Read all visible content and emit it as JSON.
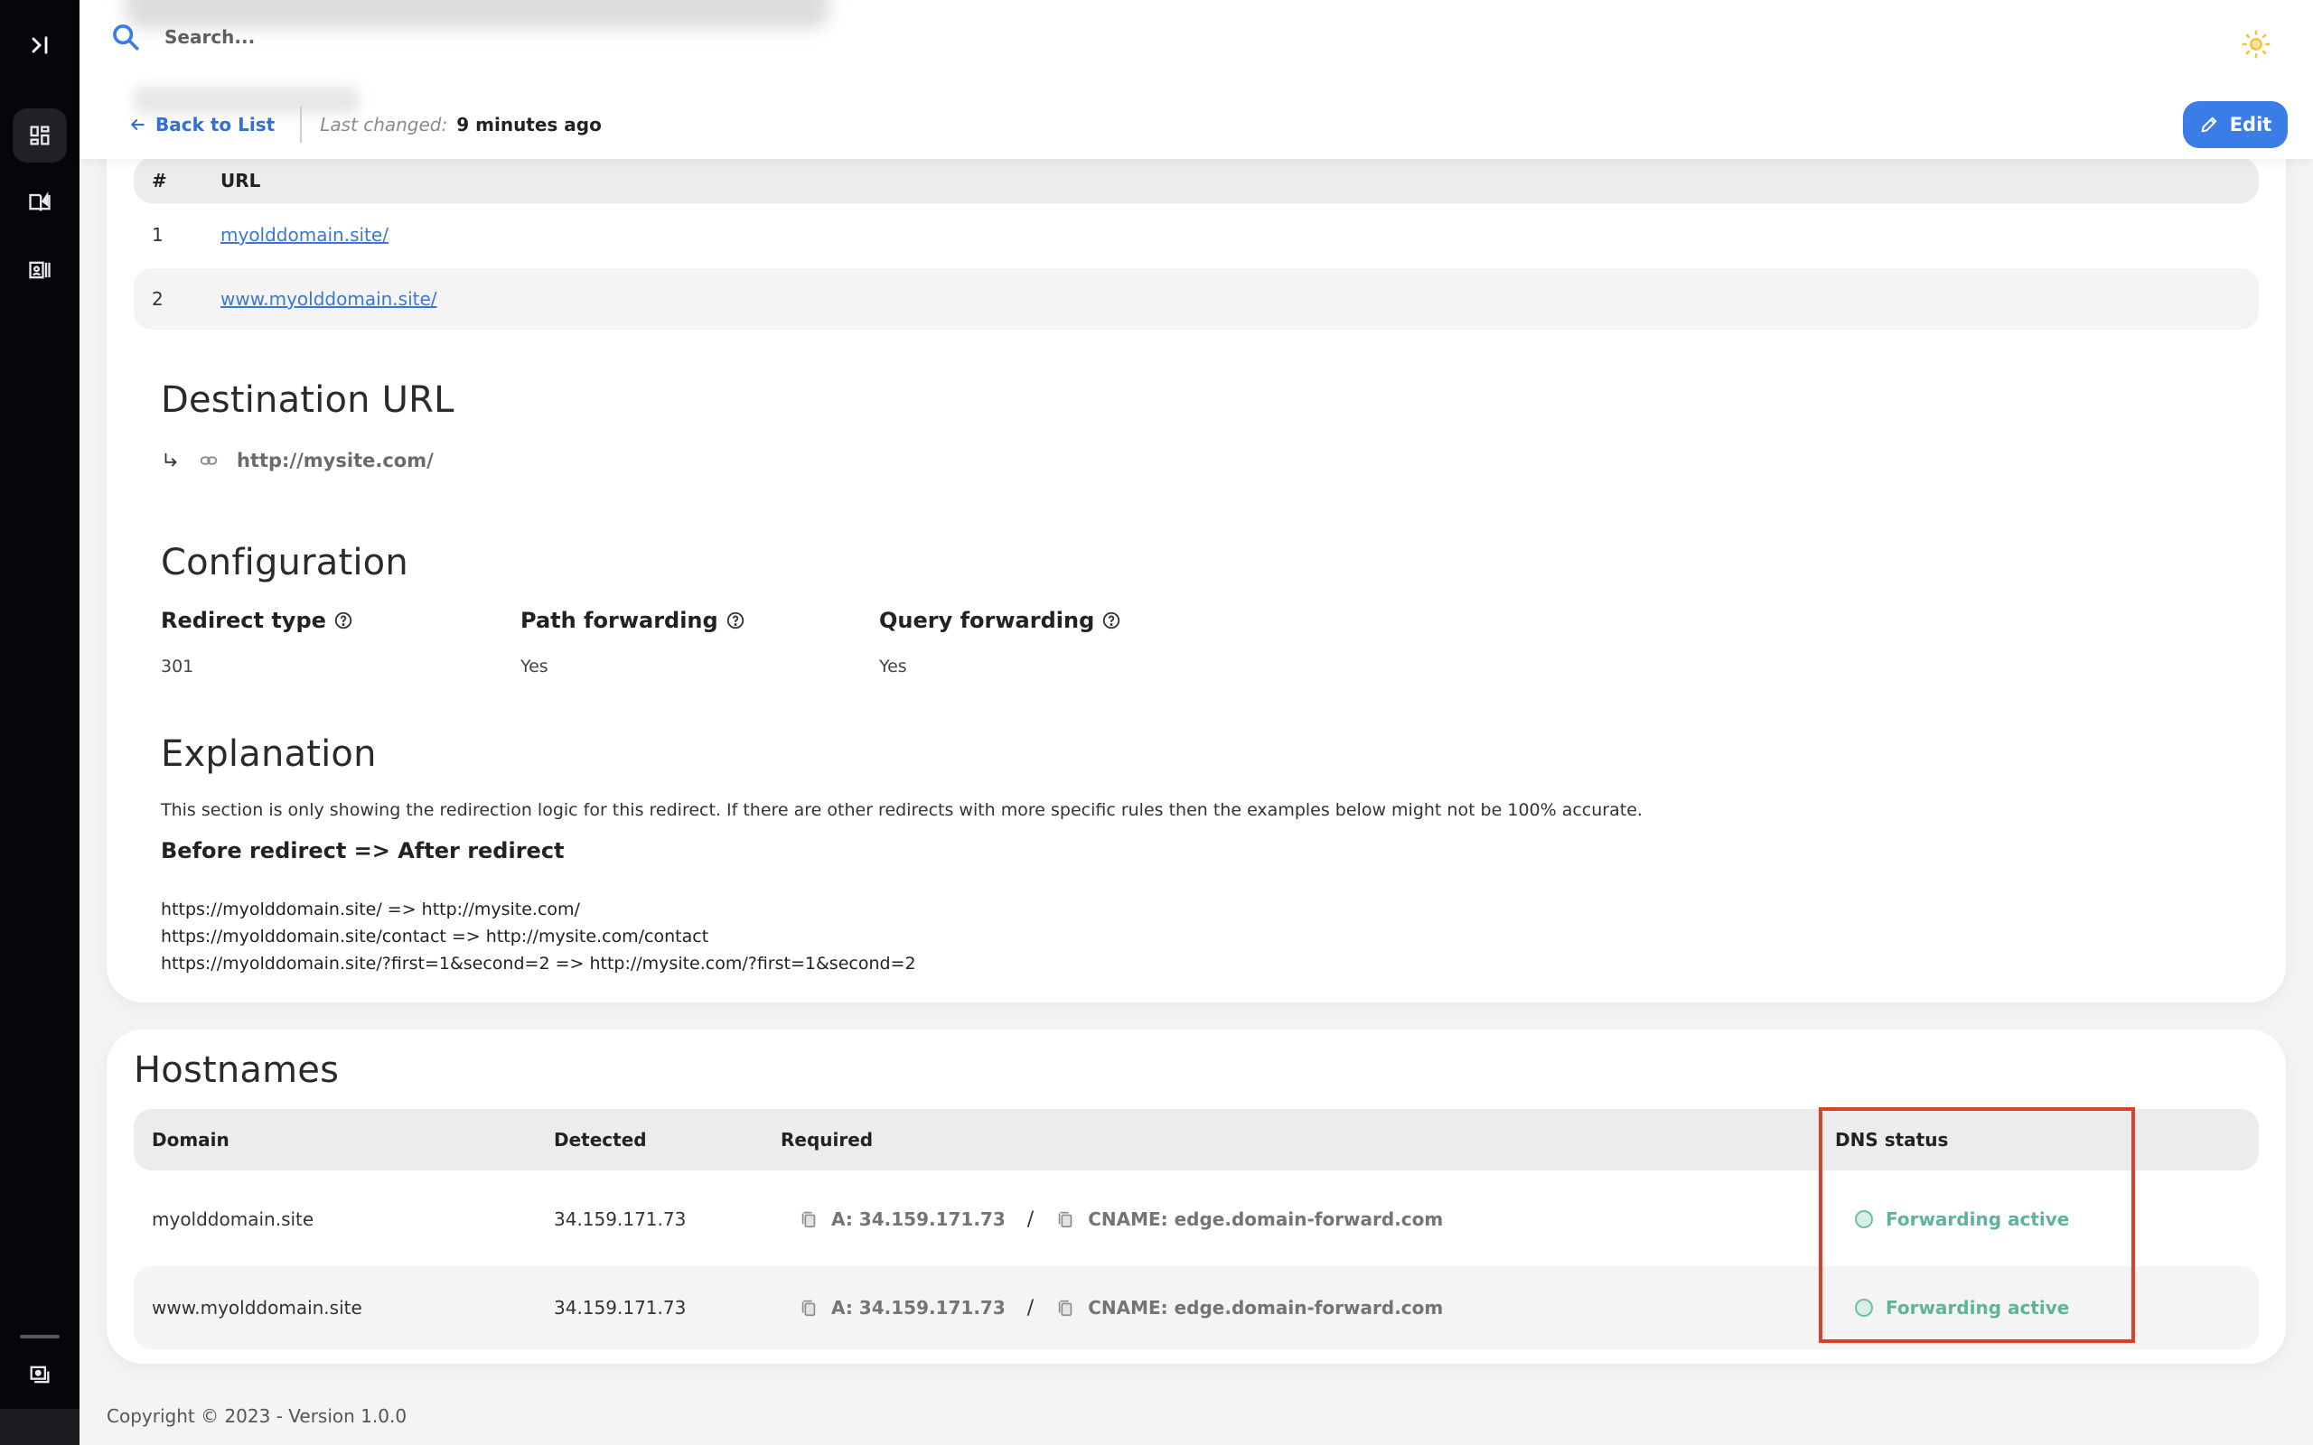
{
  "header": {
    "search_placeholder": "Search...",
    "back_label": "Back to List",
    "last_changed_label": "Last changed:",
    "last_changed_value": "9 minutes ago",
    "edit_label": "Edit"
  },
  "sidebar": {
    "items": [
      {
        "name": "expand-sidebar",
        "icon": "expand-icon"
      },
      {
        "name": "dashboard",
        "icon": "dashboard-icon",
        "active": true
      },
      {
        "name": "docs",
        "icon": "book-icon"
      },
      {
        "name": "contacts",
        "icon": "contact-card-icon"
      },
      {
        "name": "media",
        "icon": "media-icon"
      }
    ]
  },
  "source_urls": {
    "columns": [
      "#",
      "URL"
    ],
    "rows": [
      {
        "index": "1",
        "url": "myolddomain.site/"
      },
      {
        "index": "2",
        "url": "www.myolddomain.site/"
      }
    ]
  },
  "destination": {
    "title": "Destination URL",
    "url": "http://mysite.com/"
  },
  "configuration": {
    "title": "Configuration",
    "items": [
      {
        "label": "Redirect type",
        "value": "301"
      },
      {
        "label": "Path forwarding",
        "value": "Yes"
      },
      {
        "label": "Query forwarding",
        "value": "Yes"
      }
    ]
  },
  "explanation": {
    "title": "Explanation",
    "text": "This section is only showing the redirection logic for this redirect. If there are other redirects with more specific rules then the examples below might not be 100% accurate.",
    "subheading": "Before redirect => After redirect",
    "examples": [
      "https://myolddomain.site/ => http://mysite.com/",
      "https://myolddomain.site/contact => http://mysite.com/contact",
      "https://myolddomain.site/?first=1&second=2 => http://mysite.com/?first=1&second=2"
    ]
  },
  "hostnames": {
    "title": "Hostnames",
    "columns": [
      "Domain",
      "Detected",
      "Required",
      "DNS status"
    ],
    "rows": [
      {
        "domain": "myolddomain.site",
        "detected": "34.159.171.73",
        "required_a": "A: 34.159.171.73",
        "separator": "/",
        "required_cname": "CNAME: edge.domain-forward.com",
        "status": "Forwarding active"
      },
      {
        "domain": "www.myolddomain.site",
        "detected": "34.159.171.73",
        "required_a": "A: 34.159.171.73",
        "separator": "/",
        "required_cname": "CNAME: edge.domain-forward.com",
        "status": "Forwarding active"
      }
    ]
  },
  "colors": {
    "accent": "#3b7de6",
    "status_active": "#5fb39a",
    "highlight": "#d9402e",
    "sidebar_bg": "#04060a"
  },
  "footer": {
    "text": "Copyright © 2023 - Version 1.0.0"
  }
}
